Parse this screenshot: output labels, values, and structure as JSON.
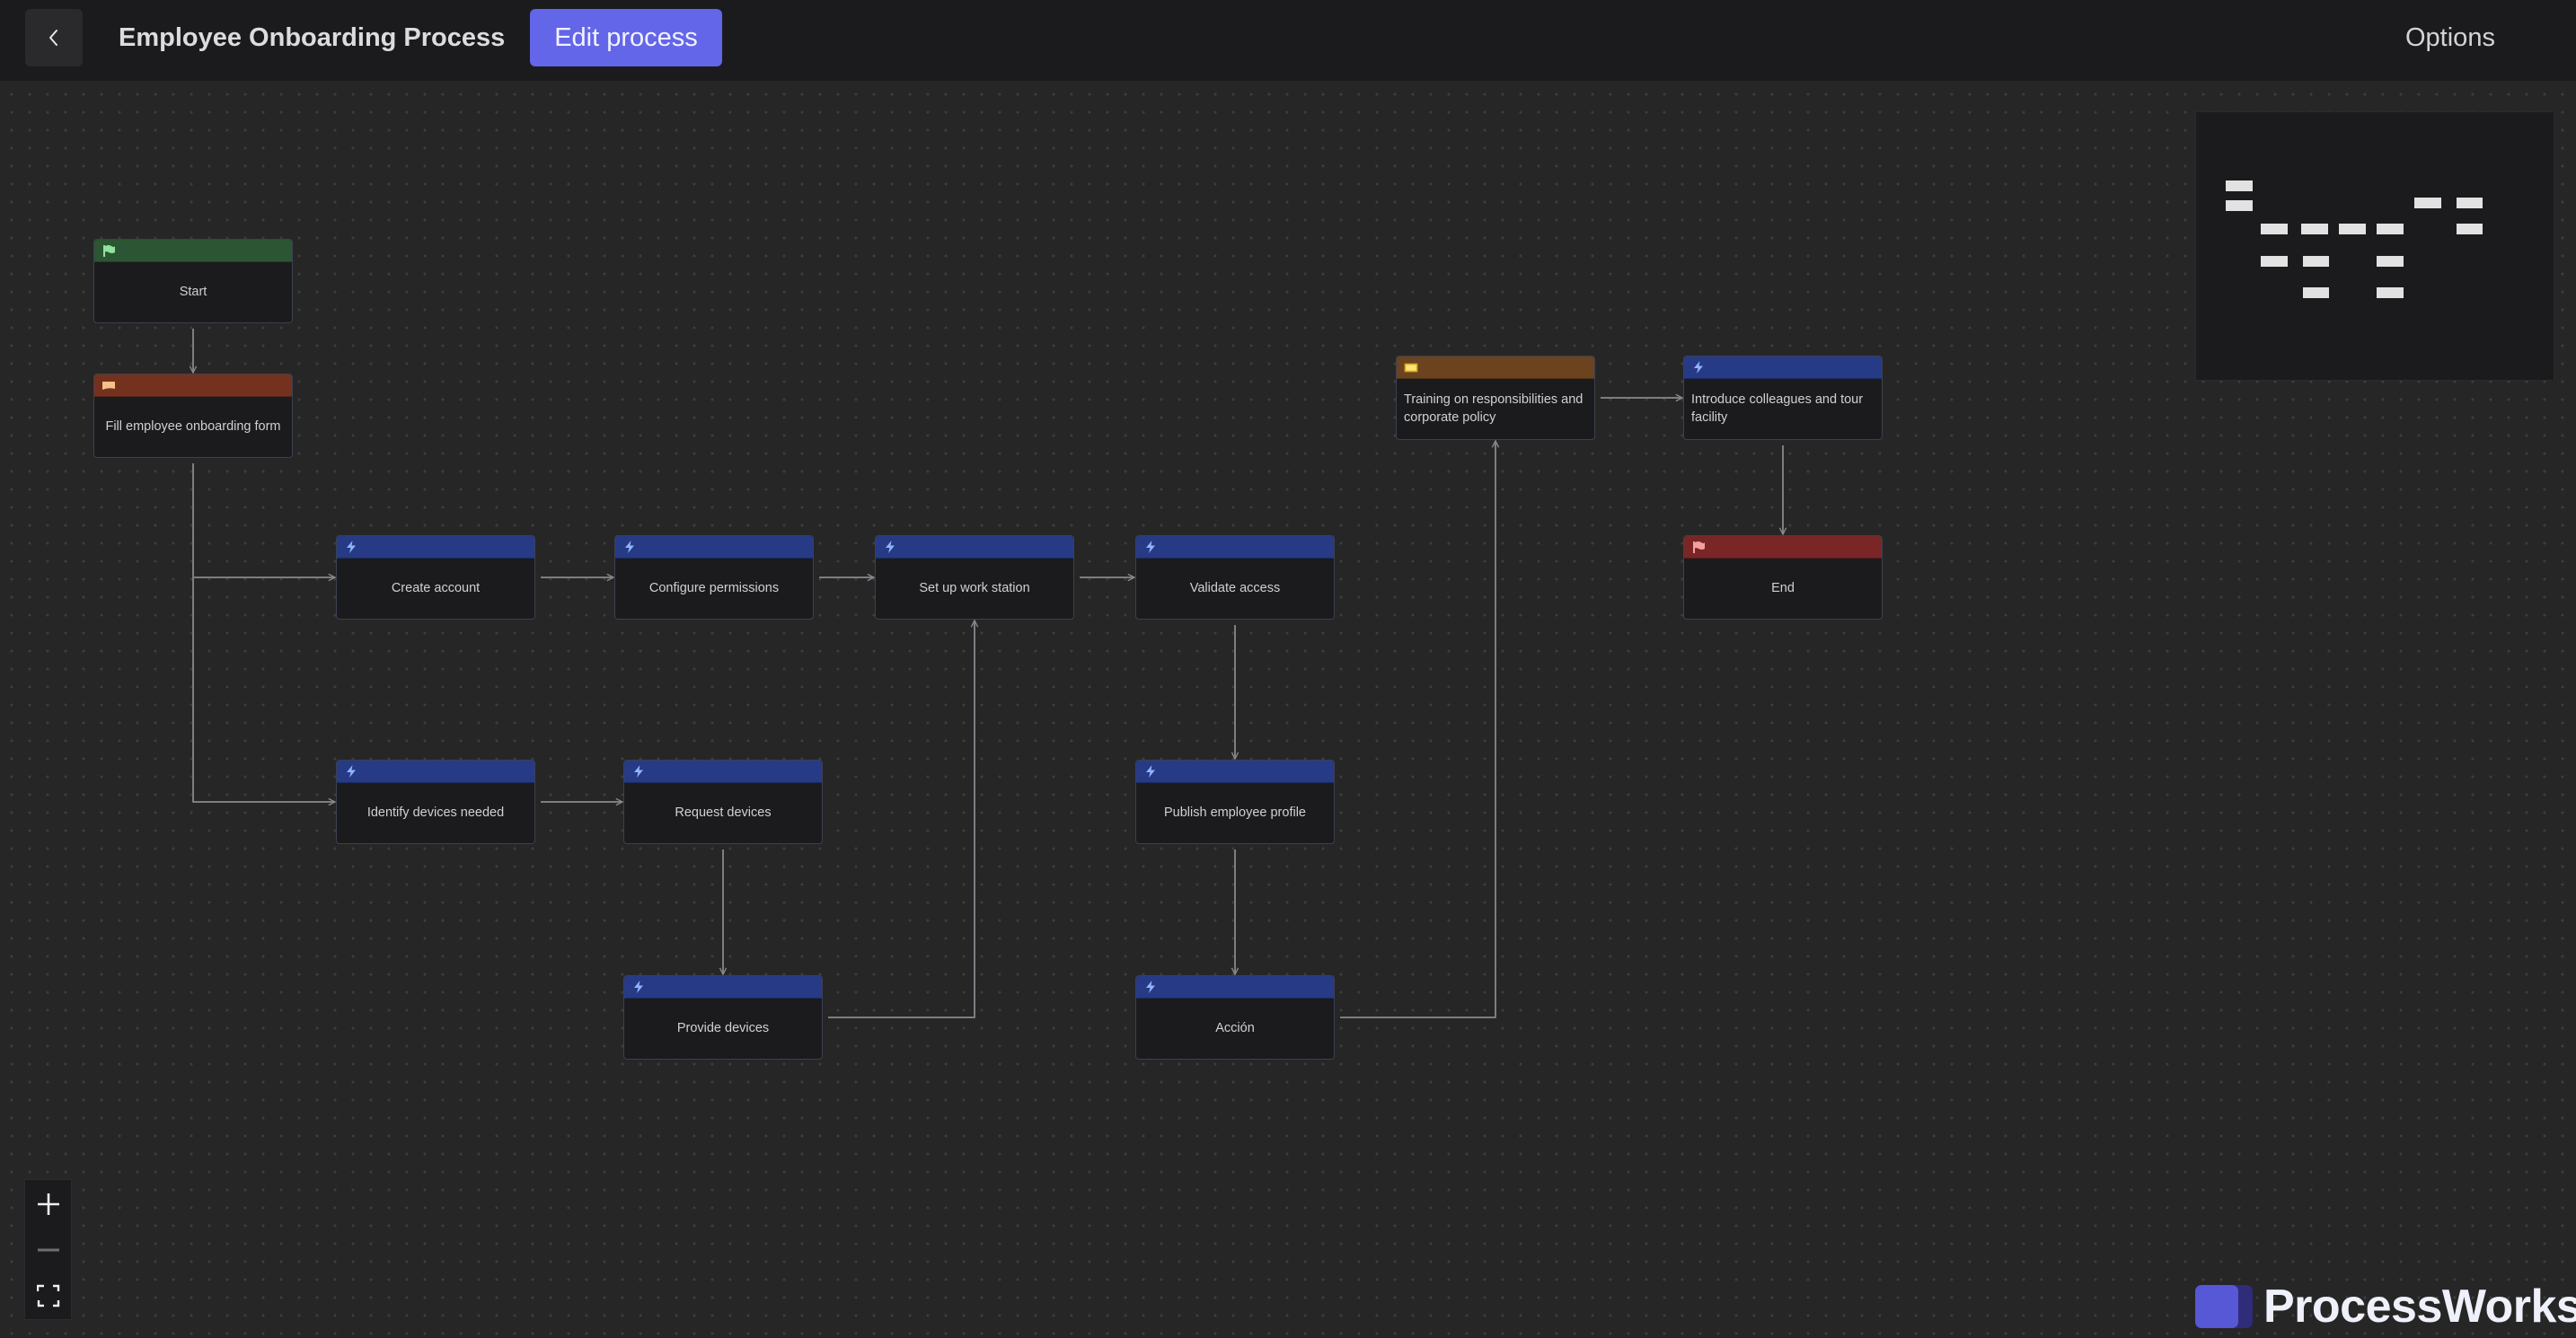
{
  "header": {
    "back_label": "Back",
    "title": "Employee Onboarding Process",
    "edit_button": "Edit process",
    "options_button": "Options"
  },
  "colors": {
    "accent": "#6366e8",
    "start_header": "#2c5534",
    "form_header": "#74311e",
    "task_header": "#263a86",
    "training_header": "#6b431f",
    "end_header": "#7a2626"
  },
  "nodes": [
    {
      "id": "start",
      "label": "Start",
      "kind": "start",
      "icon": "flag-icon"
    },
    {
      "id": "fill_form",
      "label": "Fill employee onboarding form",
      "kind": "form",
      "icon": "form-icon"
    },
    {
      "id": "create_account",
      "label": "Create account",
      "kind": "task",
      "icon": "lightning-icon"
    },
    {
      "id": "configure_permissions",
      "label": "Configure permissions",
      "kind": "task",
      "icon": "lightning-icon"
    },
    {
      "id": "setup_workstation",
      "label": "Set up work station",
      "kind": "task",
      "icon": "lightning-icon"
    },
    {
      "id": "validate_access",
      "label": "Validate access",
      "kind": "task",
      "icon": "lightning-icon"
    },
    {
      "id": "identify_devices",
      "label": "Identify devices needed",
      "kind": "task",
      "icon": "lightning-icon"
    },
    {
      "id": "request_devices",
      "label": "Request devices",
      "kind": "task",
      "icon": "lightning-icon"
    },
    {
      "id": "provide_devices",
      "label": "Provide devices",
      "kind": "task",
      "icon": "lightning-icon"
    },
    {
      "id": "publish_profile",
      "label": "Publish employee profile",
      "kind": "task",
      "icon": "lightning-icon"
    },
    {
      "id": "accion",
      "label": "Acción",
      "kind": "task",
      "icon": "lightning-icon"
    },
    {
      "id": "training",
      "label": "Training on responsibilities and corporate policy",
      "kind": "training",
      "icon": "video-icon"
    },
    {
      "id": "introduce",
      "label": "Introduce colleagues and tour facility",
      "kind": "task",
      "icon": "lightning-icon"
    },
    {
      "id": "end",
      "label": "End",
      "kind": "end",
      "icon": "flag-icon"
    }
  ],
  "edges": [
    {
      "from": "start",
      "to": "fill_form"
    },
    {
      "from": "fill_form",
      "to": "create_account"
    },
    {
      "from": "fill_form",
      "to": "identify_devices"
    },
    {
      "from": "create_account",
      "to": "configure_permissions"
    },
    {
      "from": "configure_permissions",
      "to": "setup_workstation"
    },
    {
      "from": "setup_workstation",
      "to": "validate_access"
    },
    {
      "from": "identify_devices",
      "to": "request_devices"
    },
    {
      "from": "request_devices",
      "to": "provide_devices"
    },
    {
      "from": "provide_devices",
      "to": "setup_workstation"
    },
    {
      "from": "validate_access",
      "to": "publish_profile"
    },
    {
      "from": "publish_profile",
      "to": "accion"
    },
    {
      "from": "accion",
      "to": "training"
    },
    {
      "from": "training",
      "to": "introduce"
    },
    {
      "from": "introduce",
      "to": "end"
    }
  ],
  "controls": {
    "zoom_in": "Zoom in",
    "zoom_out": "Zoom out",
    "fit_view": "Fit view"
  },
  "brand": {
    "name": "ProcessWorks"
  }
}
